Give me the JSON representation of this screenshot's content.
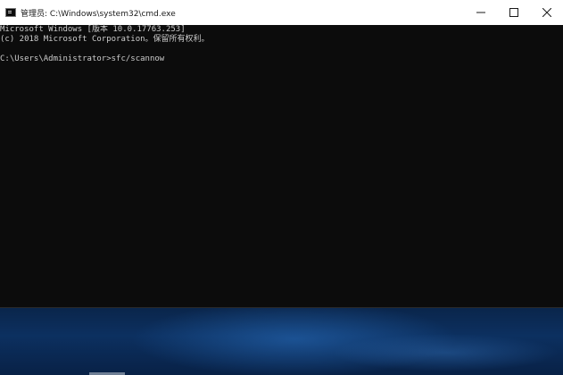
{
  "window": {
    "title": "管理员: C:\\Windows\\system32\\cmd.exe",
    "controls": {
      "minimize_icon": "minimize-icon",
      "maximize_icon": "maximize-icon",
      "close_icon": "close-icon"
    }
  },
  "console": {
    "lines": [
      "Microsoft Windows [版本 10.0.17763.253]",
      "(c) 2018 Microsoft Corporation。保留所有权利。",
      "",
      "C:\\Users\\Administrator>sfc/scannow"
    ],
    "text_color": "#cccccc",
    "background_color": "#0c0c0c"
  },
  "desktop": {
    "accent": "#0c3060"
  }
}
